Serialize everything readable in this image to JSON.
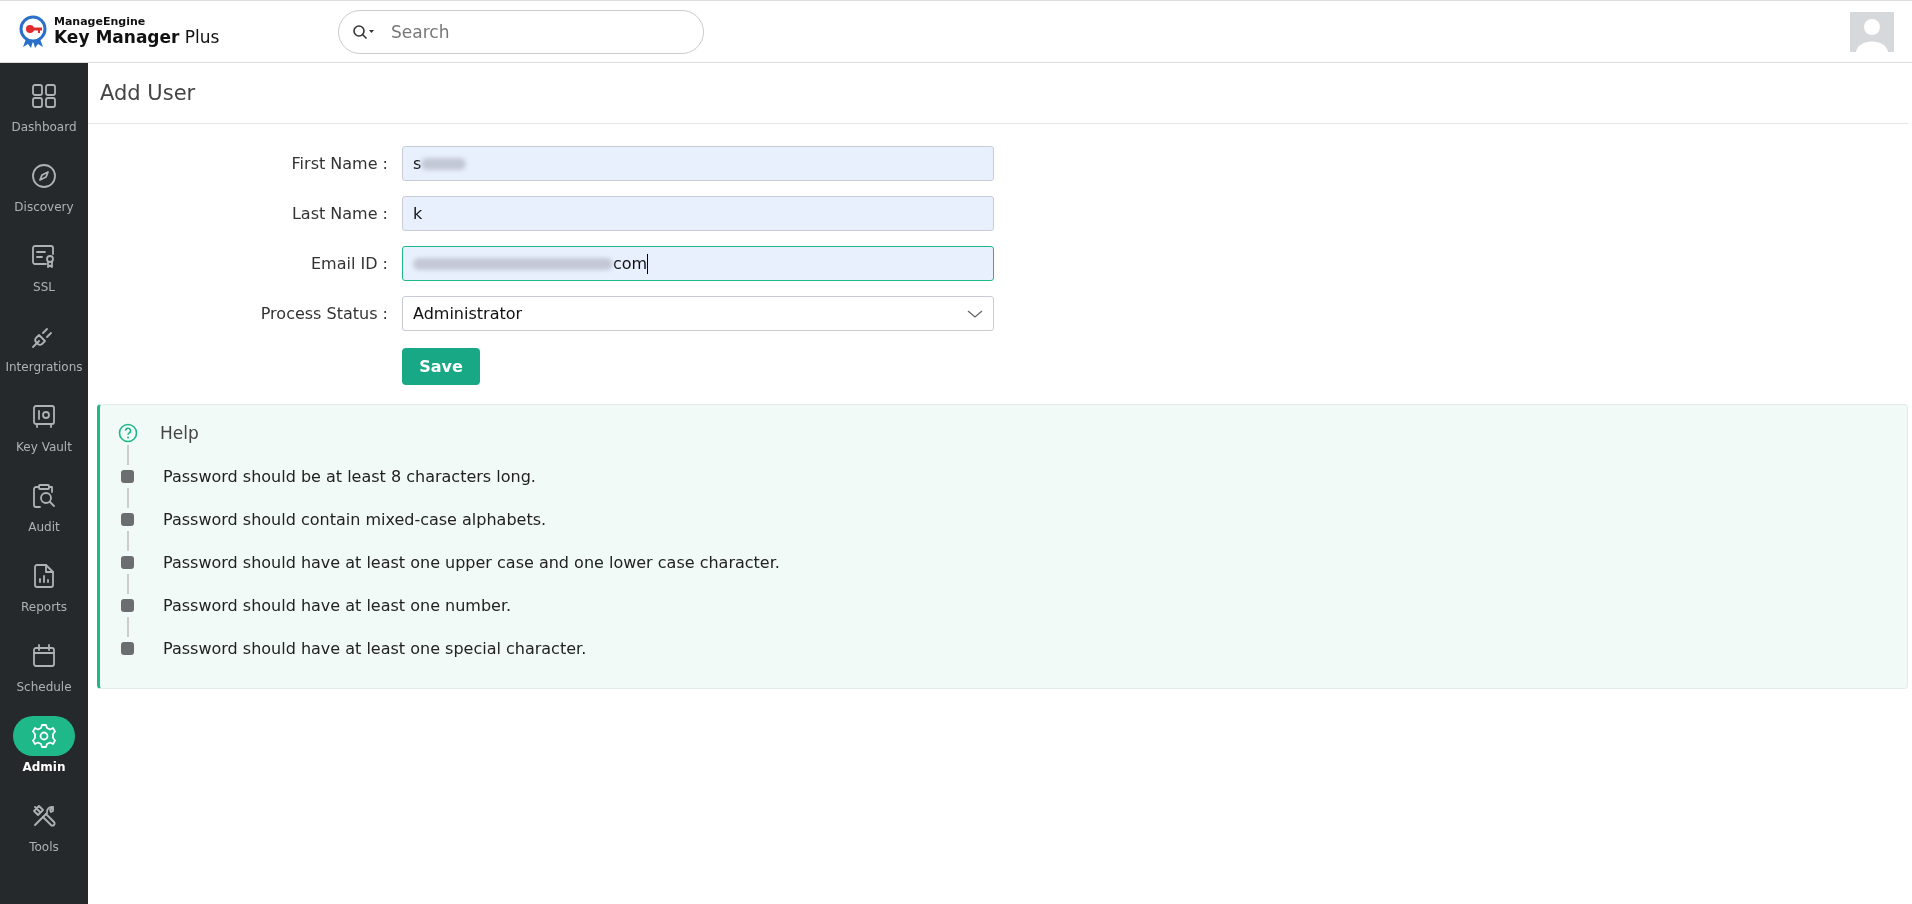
{
  "header": {
    "brand_top": "ManageEngine",
    "brand_name": "Key Manager",
    "brand_suffix": "Plus",
    "search": {
      "placeholder": "Search"
    }
  },
  "sidebar": {
    "items": [
      {
        "label": "Dashboard",
        "selected": false
      },
      {
        "label": "Discovery",
        "selected": false
      },
      {
        "label": "SSL",
        "selected": false
      },
      {
        "label": "Intergrations",
        "selected": false
      },
      {
        "label": "Key Vault",
        "selected": false
      },
      {
        "label": "Audit",
        "selected": false
      },
      {
        "label": "Reports",
        "selected": false
      },
      {
        "label": "Schedule",
        "selected": false
      },
      {
        "label": "Admin",
        "selected": true
      },
      {
        "label": "Tools",
        "selected": false
      }
    ]
  },
  "page": {
    "title": "Add User"
  },
  "form": {
    "fields": [
      {
        "kind": "text",
        "label": "First Name",
        "value": "s",
        "blur_before": false,
        "blur_after": true,
        "focused": false
      },
      {
        "kind": "text",
        "label": "Last Name",
        "value": "k",
        "blur_before": false,
        "blur_after": false,
        "focused": false
      },
      {
        "kind": "text",
        "label": "Email ID",
        "value": "com",
        "blur_before": true,
        "blur_after": false,
        "focused": true
      },
      {
        "kind": "select",
        "label": "Process Status",
        "value": "Administrator"
      }
    ],
    "separator": ":",
    "save_button": "Save"
  },
  "help": {
    "title": "Help",
    "items": [
      "Password should be at least 8 characters long.",
      "Password should contain mixed-case alphabets.",
      "Password should have at least one upper case and one lower case character.",
      "Password should have at least one number.",
      "Password should have at least one special character."
    ]
  }
}
